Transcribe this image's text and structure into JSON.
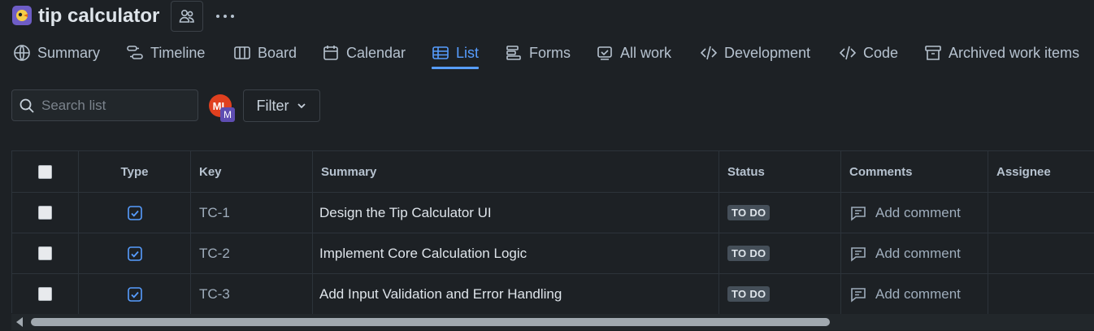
{
  "project": {
    "title": "tip calculator",
    "icon": "project-logo-icon",
    "people_icon": "people-icon",
    "more_icon": "more-horizontal-icon"
  },
  "tabs": [
    {
      "label": "Summary",
      "icon": "globe-icon"
    },
    {
      "label": "Timeline",
      "icon": "timeline-icon"
    },
    {
      "label": "Board",
      "icon": "board-icon"
    },
    {
      "label": "Calendar",
      "icon": "calendar-icon"
    },
    {
      "label": "List",
      "icon": "list-icon",
      "active": true
    },
    {
      "label": "Forms",
      "icon": "forms-icon"
    },
    {
      "label": "All work",
      "icon": "all-work-icon"
    },
    {
      "label": "Development",
      "icon": "development-icon"
    },
    {
      "label": "Code",
      "icon": "code-icon"
    },
    {
      "label": "Archived work items",
      "icon": "archive-icon"
    }
  ],
  "toolbar": {
    "search_placeholder": "Search list",
    "search_value": "",
    "avatar_initials": "ML",
    "avatar_secondary": "M",
    "filter_label": "Filter"
  },
  "table": {
    "columns": [
      "Type",
      "Key",
      "Summary",
      "Status",
      "Comments",
      "Assignee"
    ],
    "rows": [
      {
        "key": "TC-1",
        "summary": "Design the Tip Calculator UI",
        "status": "TO DO",
        "comment": "Add comment"
      },
      {
        "key": "TC-2",
        "summary": "Implement Core Calculation Logic",
        "status": "TO DO",
        "comment": "Add comment"
      },
      {
        "key": "TC-3",
        "summary": "Add Input Validation and Error Handling",
        "status": "TO DO",
        "comment": "Add comment"
      }
    ]
  },
  "colors": {
    "background": "#1d2125",
    "accent": "#579dff",
    "project_icon": "#6e5dc6",
    "avatar": "#e0401f",
    "status_lozenge": "#454f59"
  }
}
